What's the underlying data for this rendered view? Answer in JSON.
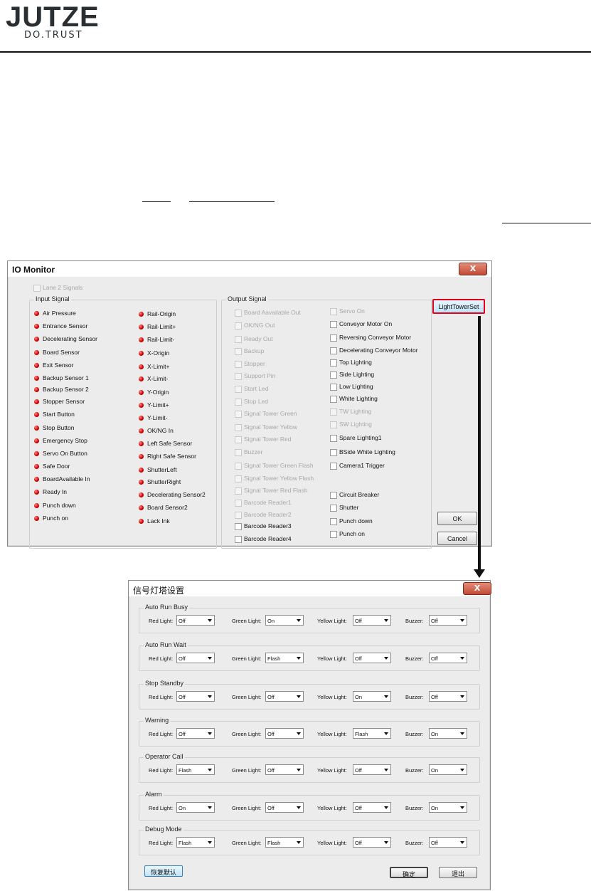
{
  "header": {
    "brand": "JUTZE",
    "tagline": "DO.TRUST"
  },
  "io_monitor": {
    "title": "IO Monitor",
    "close": "X",
    "lane2": "Lane 2 Signals",
    "input_group": "Input Signal",
    "output_group": "Output Signal",
    "input_col1": [
      "Air Pressure",
      "Entrance Sensor",
      "Decelerating Sensor",
      "Board Sensor",
      "Exit Sensor",
      "Backup Sensor 1",
      "Backup Sensor 2",
      "Stopper Sensor",
      "Start Button",
      "Stop Button",
      "Emergency Stop",
      "Servo On Button",
      "Safe Door",
      "BoardAvailable In",
      "Ready In",
      "Punch down",
      "Punch on"
    ],
    "input_col2": [
      "Rail-Origin",
      "Rail-Limit+",
      "Rail-Limit-",
      "X-Origin",
      "X-Limit+",
      "X-Limit-",
      "Y-Origin",
      "Y-Limit+",
      "Y-Limit-",
      "OK/NG In",
      "Left Safe Sensor",
      "Right Safe Sensor",
      "ShutterLeft",
      "ShutterRight",
      "Decelerating Sensor2",
      "Board Sensor2",
      "Lack Ink"
    ],
    "output_col1": [
      "Board Aavailable Out",
      "OK/NG Out",
      "Ready Out",
      "Backup",
      "Stopper",
      "Support Pin",
      "Start Led",
      "Stop Led",
      "Signal Tower Green",
      "Signal Tower Yellow",
      "Signal Tower Red",
      "Buzzer",
      "Signal Tower Green Flash",
      "Signal Tower Yellow Flash",
      "Signal Tower Red Flash",
      "Barcode Reader1",
      "Barcode Reader2",
      "Barcode Reader3",
      "Barcode Reader4"
    ],
    "output_col2a": [
      "Servo On",
      "Conveyor Motor On",
      "Reversing Conveyor Motor",
      "Decelerating Conveyor Motor",
      "Top Lighting",
      "Side Lighting",
      "Low Lighting",
      "White Lighting",
      "TW Lighting",
      "SW Lighting"
    ],
    "output_col2b": [
      "Spare Lighting1",
      "BSide White Lighting",
      "Camera1 Trigger"
    ],
    "output_col2c": [
      "Circuit Breaker",
      "Shutter",
      "Punch down",
      "Punch on"
    ],
    "light_tower_button": "LightTowerSet",
    "ok": "OK",
    "cancel": "Cancel",
    "highlight_color": "#e0001b"
  },
  "light_tower": {
    "title": "信号灯塔设置",
    "close": "X",
    "field_labels": [
      "Red Light:",
      "Green Light:",
      "Yellow Light:",
      "Buzzer:"
    ],
    "modes": [
      {
        "name": "Auto Run Busy",
        "values": [
          "Off",
          "On",
          "Off",
          "Off"
        ]
      },
      {
        "name": "Auto Run Wait",
        "values": [
          "Off",
          "Flash",
          "Off",
          "Off"
        ]
      },
      {
        "name": "Stop Standby",
        "values": [
          "Off",
          "Off",
          "On",
          "Off"
        ]
      },
      {
        "name": "Warning",
        "values": [
          "Off",
          "Off",
          "Flash",
          "On"
        ]
      },
      {
        "name": "Operator Call",
        "values": [
          "Flash",
          "Off",
          "Off",
          "On"
        ]
      },
      {
        "name": "Alarm",
        "values": [
          "On",
          "Off",
          "Off",
          "On"
        ]
      },
      {
        "name": "Debug Mode",
        "values": [
          "Flash",
          "Flash",
          "Off",
          "Off"
        ]
      }
    ],
    "restore_default": "恢复默认",
    "confirm": "确定",
    "exit": "退出"
  }
}
